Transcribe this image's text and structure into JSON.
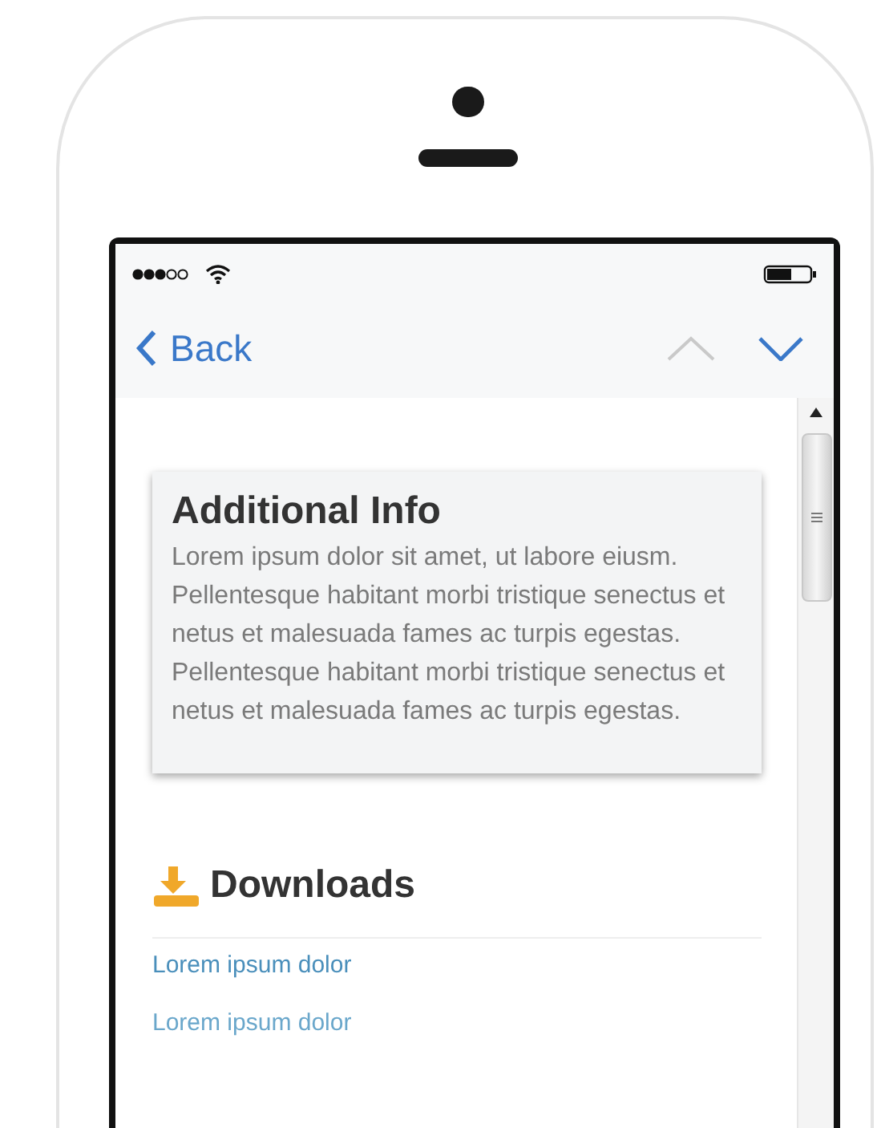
{
  "nav_bar": {
    "back_label": "Back",
    "previous": {
      "disabled": true
    },
    "next": {
      "disabled": false
    }
  },
  "info_card": {
    "title": "Additional Info",
    "body": "Lorem ipsum dolor sit amet, ut labore eiusm. Pellentesque habitant morbi tristique senectus et netus et malesuada fames ac turpis egestas. Pellentesque habitant morbi tristique senectus et netus et malesuada fames ac turpis egestas."
  },
  "downloads": {
    "title": "Downloads",
    "links": [
      "Lorem ipsum dolor",
      "Lorem ipsum dolor"
    ]
  }
}
